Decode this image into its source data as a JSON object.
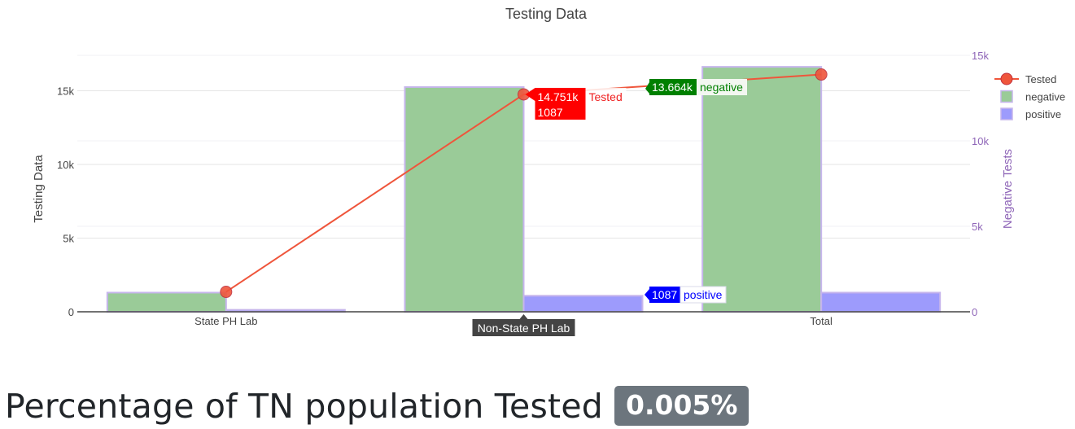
{
  "chart_data": {
    "type": "bar",
    "title": "Testing Data",
    "categories": [
      "State PH Lab",
      "Non-State PH Lab",
      "Total"
    ],
    "y_left": {
      "label": "Testing Data",
      "range": [
        0,
        17400
      ],
      "ticks": [
        0,
        5000,
        10000,
        15000
      ],
      "tick_labels": [
        "0",
        "5k",
        "10k",
        "15k"
      ]
    },
    "y_right": {
      "label": "Negative Tests",
      "range": [
        0,
        15000
      ],
      "ticks": [
        0,
        5000,
        10000,
        15000
      ],
      "tick_labels": [
        "0",
        "5k",
        "10k",
        "15k"
      ]
    },
    "series": [
      {
        "name": "Tested",
        "kind": "line+markers",
        "axis": "left",
        "color": "#ef553b",
        "values": [
          1350,
          14751,
          16100
        ]
      },
      {
        "name": "negative",
        "kind": "bar",
        "axis": "left",
        "color": "#9acb98",
        "border": "#c6b5ec",
        "values": [
          1300,
          15250,
          16620
        ]
      },
      {
        "name": "positive",
        "kind": "bar",
        "axis": "left",
        "color": "#9d9bfc",
        "border": "#c6b5ec",
        "values": [
          130,
          1087,
          1300
        ]
      }
    ],
    "hover_labels": [
      {
        "text": "14.751k",
        "extra": "1087",
        "name": "Tested",
        "bg": "#ff0000",
        "name_color": "#ef2020"
      },
      {
        "text": "13.664k",
        "name": "negative",
        "bg": "#008000",
        "name_color": "#008000"
      },
      {
        "text": "1087",
        "name": "positive",
        "bg": "#0000ff",
        "name_color": "#0000ff"
      }
    ],
    "x_hover_label": "Non-State PH Lab",
    "legend": {
      "position": "top-right",
      "items": [
        "Tested",
        "negative",
        "positive"
      ]
    },
    "grid": true
  },
  "footer": {
    "heading": "Percentage of TN population Tested",
    "badge": "0.005%"
  }
}
